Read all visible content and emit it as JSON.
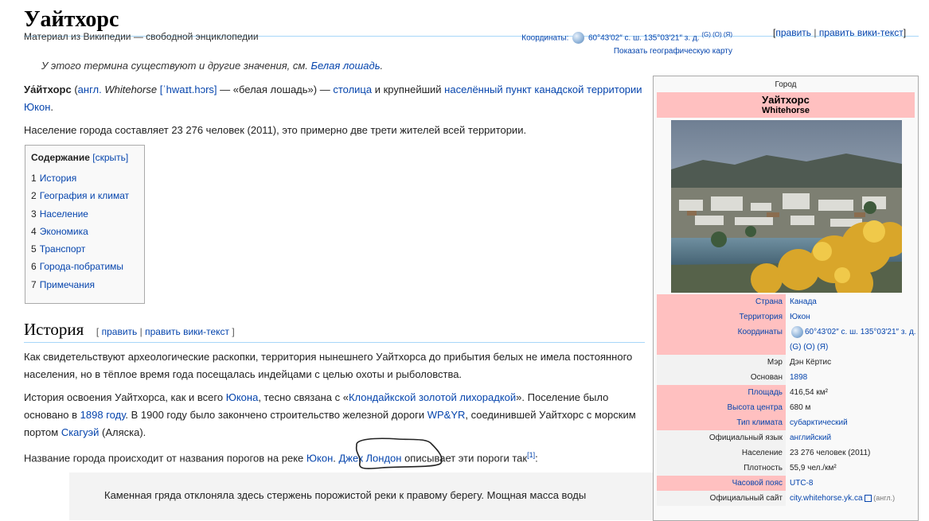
{
  "title": "Уайтхорс",
  "tagline": "Материал из Википедии — свободной энциклопедии",
  "coords_top": {
    "label": "Координаты:",
    "value": "60°43′02″ с. ш. 135°03′21″ з. д.",
    "sup": "(G) (O) (Я)",
    "map_link": "Показать географическую карту"
  },
  "edit_top": {
    "edit": "править",
    "sep": "|",
    "edit_wiki": "править вики-текст"
  },
  "disambig": {
    "text": "У этого термина существуют и другие значения, см.",
    "link": "Белая лошадь",
    "end": "."
  },
  "lead1": {
    "name": "Уа́йтхорс",
    "paren_open": " (",
    "lang": "англ.",
    "english": "Whitehorse",
    "ipa": "[ˈhwaɪt.hɔrs]",
    "gloss": " — «белая лошадь») —",
    "capital": "столица",
    "mid": " и крупнейший ",
    "settlement": "населённый пункт канадской территории Юкон",
    "end": "."
  },
  "lead2": "Население города составляет 23 276 человек (2011), это примерно две трети жителей всей территории.",
  "toc": {
    "title": "Содержание",
    "hide": "[скрыть]",
    "items": [
      {
        "num": "1",
        "label": "История"
      },
      {
        "num": "2",
        "label": "География и климат"
      },
      {
        "num": "3",
        "label": "Население"
      },
      {
        "num": "4",
        "label": "Экономика"
      },
      {
        "num": "5",
        "label": "Транспорт"
      },
      {
        "num": "6",
        "label": "Города-побратимы"
      },
      {
        "num": "7",
        "label": "Примечания"
      }
    ]
  },
  "history": {
    "heading": "История",
    "edit_open": "[",
    "edit": "править",
    "sep": "|",
    "edit_wiki": "править вики-текст",
    "edit_close": "]",
    "p1": "Как свидетельствуют археологические раскопки, территория нынешнего Уайтхорса до прибытия белых не имела постоянного населения, но в тёплое время года посещалась индейцами с целью охоты и рыболовства.",
    "p2a": "История освоения Уайтхорса, как и всего ",
    "p2_yukon": "Юкона",
    "p2b": ", тесно связана с «",
    "p2_gold": "Клондайкской золотой лихорадкой",
    "p2c": "». Поселение было основано в ",
    "p2_year": "1898 году",
    "p2d": ". В 1900 году было закончено строительство железной дороги ",
    "p2_rail": "WP&YR",
    "p2e": ", соединившей Уайтхорс с морским портом ",
    "p2_port": "Скагуэй",
    "p2f": " (Аляска).",
    "p3a": "Название города происходит от названия порогов на реке ",
    "p3_yukon": "Юкон",
    "p3b": ". ",
    "p3_london": "Джек Лондон",
    "p3c": " описывает эти пороги так",
    "p3_ref": "[1]",
    "p3d": ":",
    "quote_line1": "Каменная гряда отклоняла здесь стержень порожистой реки к правому берегу. Мощная масса воды"
  },
  "infobox": {
    "type": "Город",
    "name": "Уайтхорс",
    "name_en": "Whitehorse",
    "rows": [
      {
        "label": "Страна",
        "value": "Канада",
        "label_link": true,
        "value_link": true
      },
      {
        "label": "Территория",
        "value": "Юкон",
        "label_link": true,
        "value_link": true
      },
      {
        "label": "Координаты",
        "value": "60°43′02″ с. ш. 135°03′21″ з. д. (G) (O) (Я)",
        "label_link": true,
        "value_link": true
      },
      {
        "label": "Мэр",
        "value": "Дэн Кёртис",
        "label_link": false,
        "value_link": false
      },
      {
        "label": "Основан",
        "value": "1898",
        "label_link": false,
        "value_link": true
      },
      {
        "label": "Площадь",
        "value": "416,54 км²",
        "label_link": true,
        "value_link": false
      },
      {
        "label": "Высота центра",
        "value": "680 м",
        "label_link": true,
        "value_link": false
      },
      {
        "label": "Тип климата",
        "value": "субарктический",
        "label_link": true,
        "value_link": true
      },
      {
        "label": "Официальный язык",
        "value": "английский",
        "label_link": false,
        "value_link": true
      },
      {
        "label": "Население",
        "value": "23 276 человек (2011)",
        "label_link": false,
        "value_link": false
      },
      {
        "label": "Плотность",
        "value": "55,9 чел./км²",
        "label_link": false,
        "value_link": false
      },
      {
        "label": "Часовой пояс",
        "value": "UTC-8",
        "label_link": true,
        "value_link": true
      },
      {
        "label": "Официальный сайт",
        "value": "city.whitehorse.yk.ca",
        "note": "(англ.)",
        "label_link": false,
        "value_link": true
      }
    ]
  }
}
